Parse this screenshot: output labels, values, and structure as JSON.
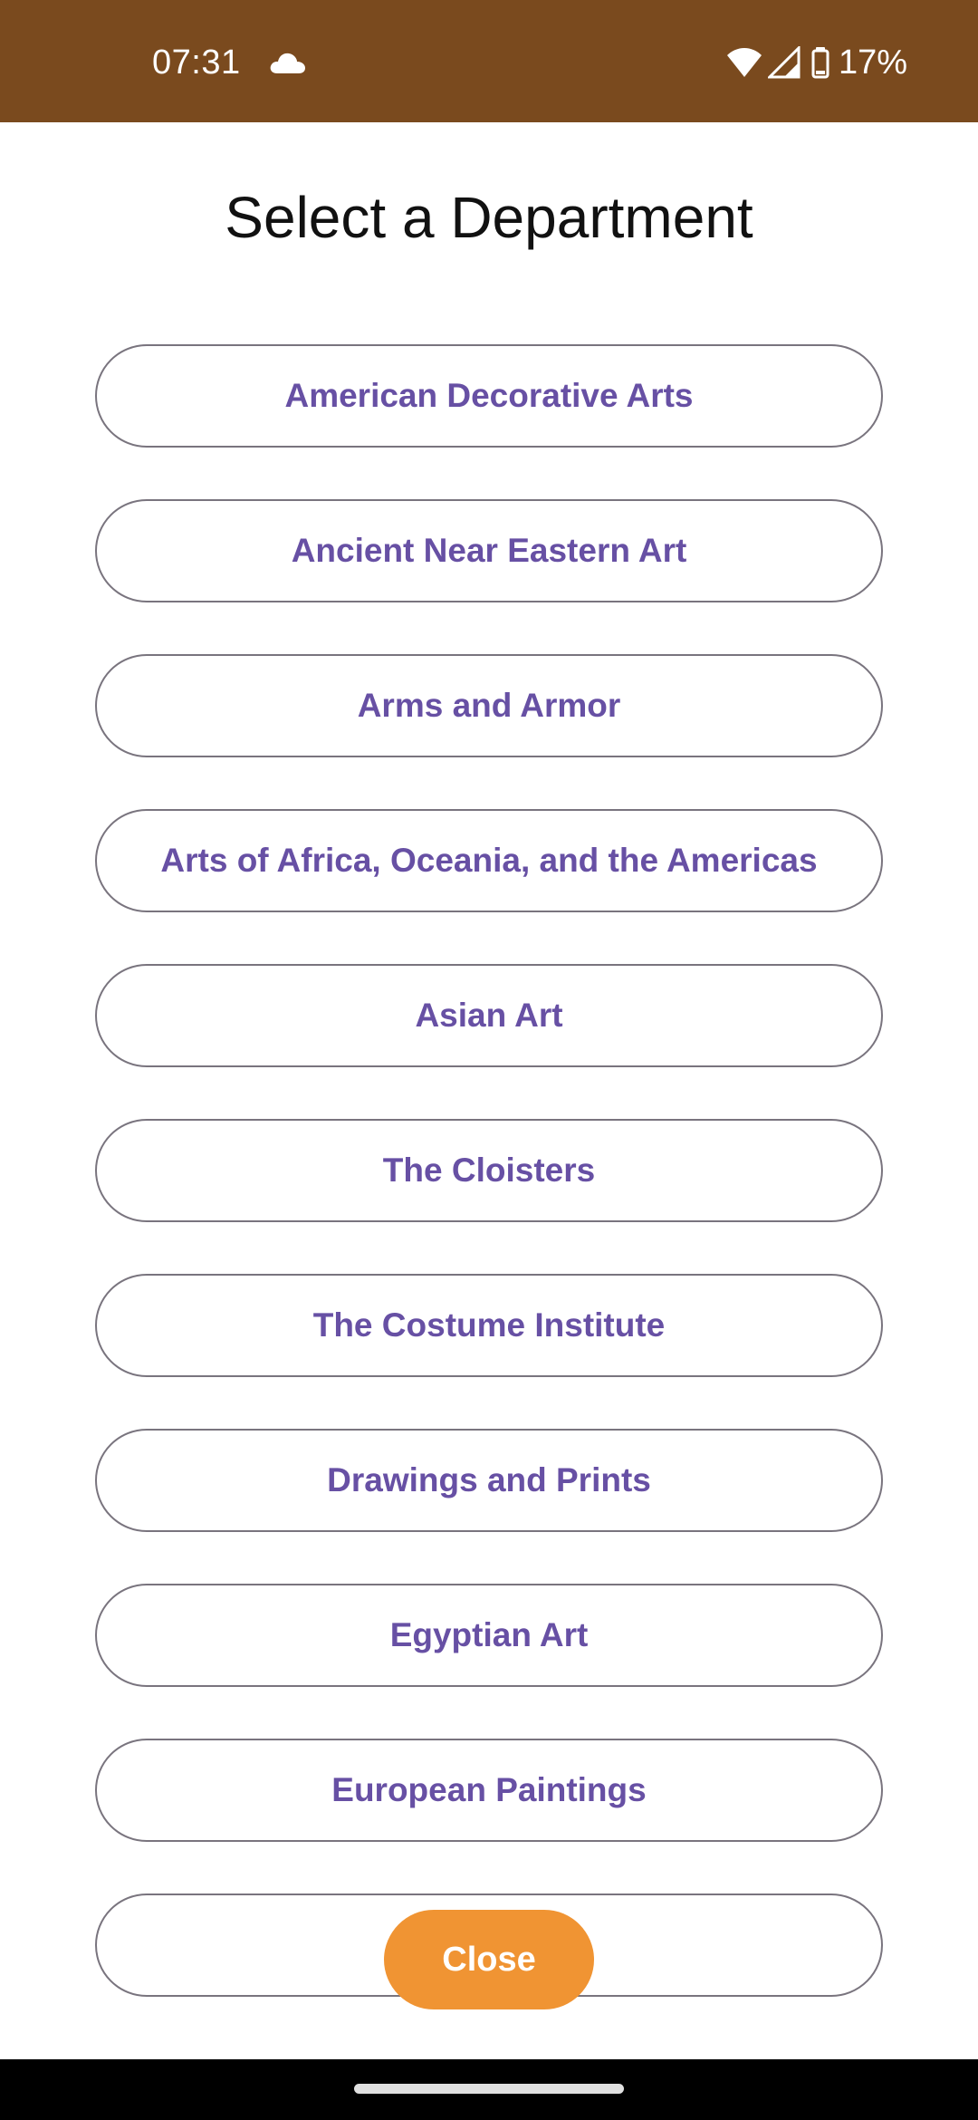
{
  "status_bar": {
    "time": "07:31",
    "battery": "17%",
    "icons": [
      "cloud-icon",
      "wifi-icon",
      "cellular-signal-icon",
      "battery-icon"
    ],
    "background_color": "#7a4a1e"
  },
  "dialog": {
    "title": "Select a Department",
    "departments": [
      {
        "label": "American Decorative Arts"
      },
      {
        "label": "Ancient Near Eastern Art"
      },
      {
        "label": "Arms and Armor"
      },
      {
        "label": "Arts of Africa, Oceania, and the Americas"
      },
      {
        "label": "Asian Art"
      },
      {
        "label": "The Cloisters"
      },
      {
        "label": "The Costume Institute"
      },
      {
        "label": "Drawings and Prints"
      },
      {
        "label": "Egyptian Art"
      },
      {
        "label": "European Paintings"
      },
      {
        "label": ""
      }
    ],
    "close_label": "Close",
    "colors": {
      "button_text": "#6750a4",
      "button_outline": "#79747e",
      "close_button": "#f09433"
    }
  },
  "navigation": {
    "home_indicator": "home-indicator"
  }
}
